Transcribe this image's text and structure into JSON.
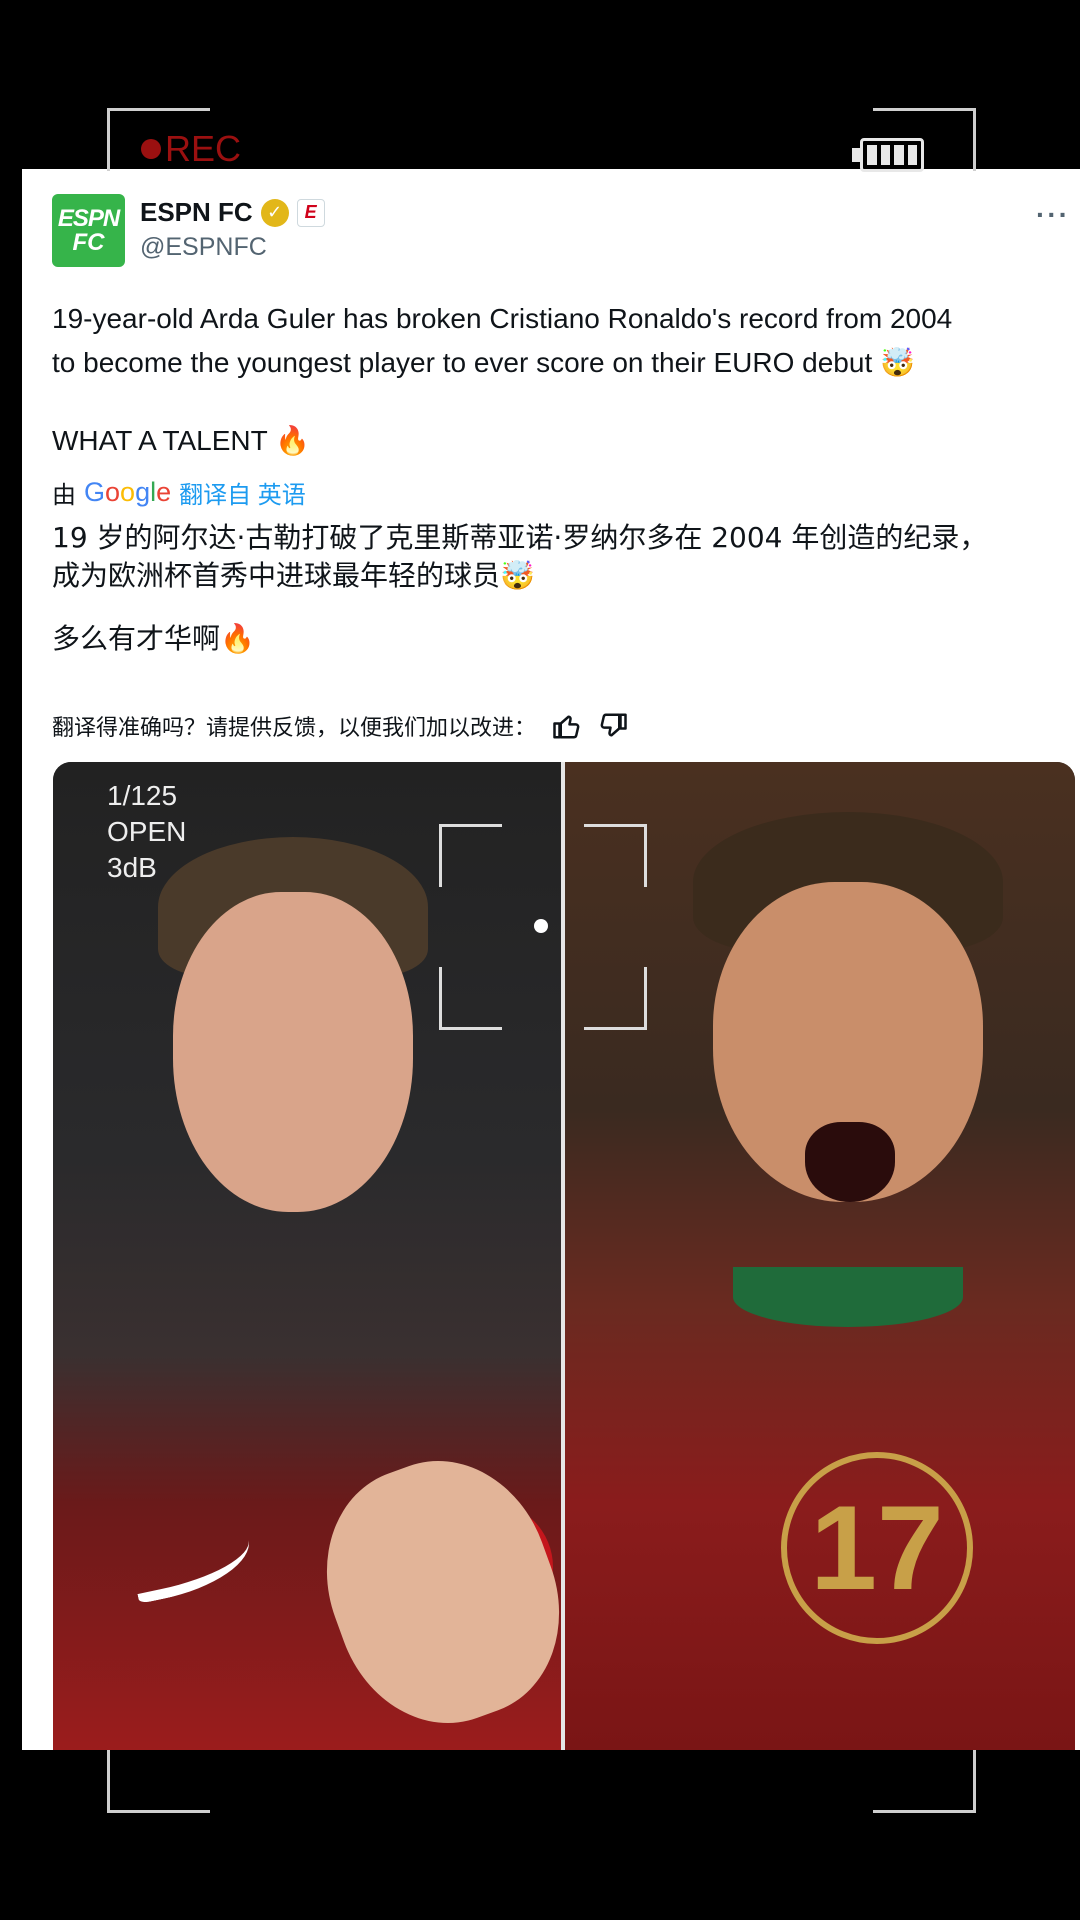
{
  "overlay": {
    "rec_label": "REC"
  },
  "tweet": {
    "author_name": "ESPN FC",
    "author_handle": "@ESPNFC",
    "avatar_line1": "ESPN",
    "avatar_line2": "FC",
    "affiliate_badge": "E",
    "more_label": "···",
    "text_line1": "19-year-old Arda Guler has broken Cristiano Ronaldo's record from 2004",
    "text_line2": "to become the youngest player to ever score on their EURO debut 🤯",
    "talent_line": "WHAT A TALENT 🔥",
    "translated_by": "由",
    "google_letters": [
      "G",
      "o",
      "o",
      "g",
      "l",
      "e"
    ],
    "translate_from": "翻译自 英语",
    "translation_line1": "19 岁的阿尔达·古勒打破了克里斯蒂亚诺·罗纳尔多在 2004 年创造的纪录，",
    "translation_line2": "成为欧洲杯首秀中进球最年轻的球员🤯",
    "translation_talent": "多么有才华啊🔥",
    "feedback_prompt": "翻译得准确吗？请提供反馈，以便我们加以改进："
  },
  "media": {
    "camera_info": [
      "1/125",
      "OPEN",
      "3dB"
    ],
    "jersey_number": "17"
  },
  "colors": {
    "espn_green": "#36b44a",
    "verified_gold": "#e2b719",
    "link_blue": "#1d9bf0",
    "rec_red": "#9b1010"
  }
}
